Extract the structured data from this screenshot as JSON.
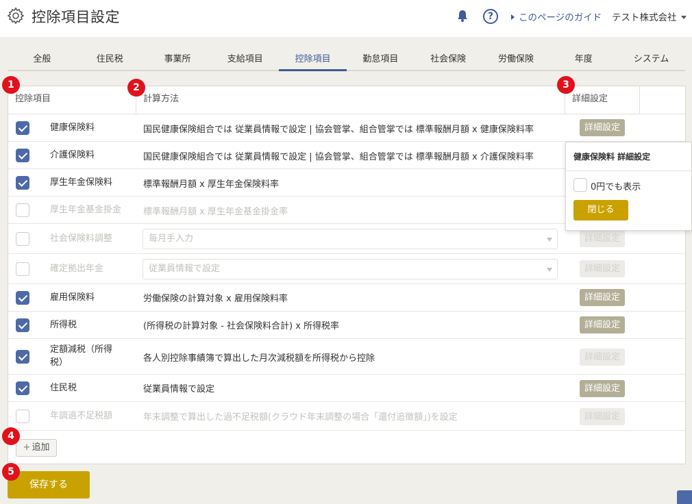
{
  "header": {
    "title": "控除項目設定",
    "guide_link": "このページのガイド",
    "company": "テスト株式会社",
    "icons": [
      "gear-icon",
      "bell-icon",
      "help-icon"
    ]
  },
  "tabs": [
    {
      "label": "全般"
    },
    {
      "label": "住民税"
    },
    {
      "label": "事業所"
    },
    {
      "label": "支給項目"
    },
    {
      "label": "控除項目",
      "active": true
    },
    {
      "label": "勤怠項目"
    },
    {
      "label": "社会保険"
    },
    {
      "label": "労働保険"
    },
    {
      "label": "年度"
    },
    {
      "label": "システム"
    }
  ],
  "table": {
    "headers": {
      "item": "控除項目",
      "method": "計算方法",
      "detail": "詳細設定"
    },
    "rows": [
      {
        "checked": true,
        "name": "健康保険料",
        "method": "国民健康保険組合では 従業員情報で設定 | 協会管掌、組合管掌では 標準報酬月額 x 健康保険料率",
        "detail": "詳細設定"
      },
      {
        "checked": true,
        "name": "介護保険料",
        "method": "国民健康保険組合では 従業員情報で設定 | 協会管掌、組合管掌では 標準報酬月額 x 介護保険料率",
        "detail": "詳細設定"
      },
      {
        "checked": true,
        "name": "厚生年金保険料",
        "method": "標準報酬月額 x 厚生年金保険料率",
        "detail": "詳細設定"
      },
      {
        "checked": false,
        "name": "厚生年金基金掛金",
        "method": "標準報酬月額 x 厚生年金基金掛金率",
        "detail": "詳細設定"
      },
      {
        "checked": false,
        "name": "社会保険料調整",
        "method": "毎月手入力",
        "detail": "詳細設定"
      },
      {
        "checked": false,
        "name": "確定拠出年金",
        "method": "従業員情報で設定",
        "detail": "詳細設定"
      },
      {
        "checked": true,
        "name": "雇用保険料",
        "method": "労働保険の計算対象 x 雇用保険料率",
        "detail": "詳細設定"
      },
      {
        "checked": true,
        "name": "所得税",
        "method": "(所得税の計算対象 - 社会保険料合計) x 所得税率",
        "detail": "詳細設定"
      },
      {
        "checked": true,
        "name": "定額減税（所得税）",
        "method": "各人別控除事績簿で算出した月次減税額を所得税から控除",
        "detail": "詳細設定"
      },
      {
        "checked": true,
        "name": "住民税",
        "method": "従業員情報で設定",
        "detail": "詳細設定"
      },
      {
        "checked": false,
        "name": "年調過不足税額",
        "method": "年末調整で算出した過不足税額(クラウド年末調整の場合「還付追徴額」)を設定",
        "detail": "詳細設定"
      }
    ],
    "add_label": "追加"
  },
  "popover": {
    "title": "健康保険料 詳細設定",
    "checkbox_label": "0円でも表示",
    "checkbox_checked": false,
    "close_label": "閉じる"
  },
  "save_label": "保存する",
  "badges": [
    "1",
    "2",
    "3",
    "4",
    "5"
  ],
  "colors": {
    "accent": "#3e5a9a",
    "primary_button": "#c9a200",
    "detail_button": "#b3ae96",
    "badge": "#e0121c"
  }
}
